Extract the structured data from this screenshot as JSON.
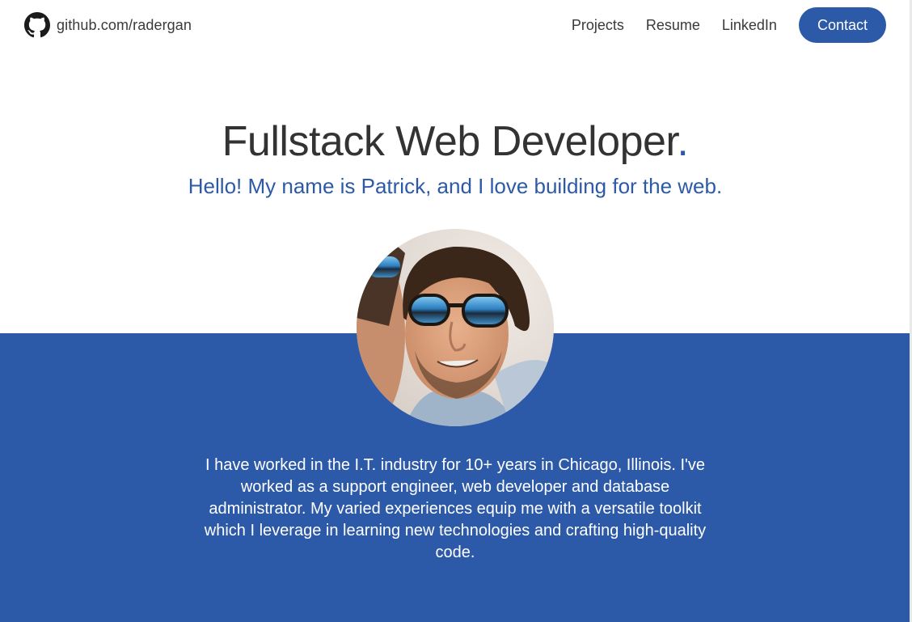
{
  "nav": {
    "github_label": "github.com/radergan",
    "links": [
      "Projects",
      "Resume",
      "LinkedIn"
    ],
    "contact_label": "Contact"
  },
  "hero": {
    "title": "Fullstack Web Developer",
    "title_dot": ".",
    "subtitle": "Hello! My name is Patrick, and I love building for the web."
  },
  "about": {
    "bio": "I have worked in the I.T. industry for 10+ years in Chicago, Illinois. I've worked as a support engineer, web developer and database administrator. My varied experiences equip me with a versatile toolkit which I leverage in learning new technologies and crafting high-quality code."
  },
  "icons": {
    "github": "github-icon"
  },
  "colors": {
    "accent": "#2c5aa8",
    "text": "#333333",
    "nav_text": "#3a3a3a",
    "background": "#ffffff"
  }
}
